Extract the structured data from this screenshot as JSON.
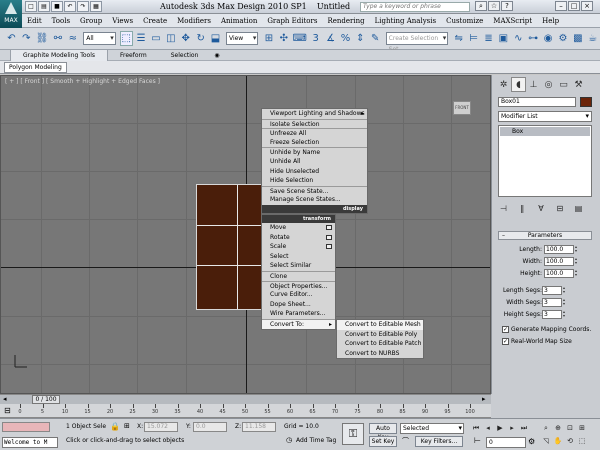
{
  "title_bar": {
    "app_logo": "MAX",
    "title": "Autodesk 3ds Max Design 2010 SP1",
    "document": "Untitled",
    "search_placeholder": "Type a keyword or phrase",
    "quick_access": [
      "new-icon",
      "open-icon",
      "save-icon",
      "undo-icon",
      "redo-icon",
      "project-icon"
    ]
  },
  "menu": [
    "Edit",
    "Tools",
    "Group",
    "Views",
    "Create",
    "Modifiers",
    "Animation",
    "Graph Editors",
    "Rendering",
    "Lighting Analysis",
    "Customize",
    "MAXScript",
    "Help"
  ],
  "toolbar": {
    "filter": "All",
    "ref_coord": "View",
    "selection_set_placeholder": "Create Selection Set"
  },
  "ribbon": {
    "tabs": [
      "Graphite Modeling Tools",
      "Freeform",
      "Selection"
    ],
    "subtab": "Polygon Modeling"
  },
  "viewport": {
    "label": "[ + ] [ Front ] [ Smooth + Highlight + Edged Faces ]",
    "viewcube_label": "FRONT"
  },
  "quad_menu": {
    "display_items": [
      "Viewport Lighting and Shadows",
      "Isolate Selection",
      "Unfreeze All",
      "Freeze Selection",
      "Unhide by Name",
      "Unhide All",
      "Hide Unselected",
      "Hide Selection",
      "Save Scene State...",
      "Manage Scene States..."
    ],
    "display_header": "display",
    "transform_header": "transform",
    "transform_items": [
      "Move",
      "Rotate",
      "Scale",
      "Select",
      "Select Similar",
      "Clone",
      "Object Properties...",
      "Curve Editor...",
      "Dope Sheet...",
      "Wire Parameters...",
      "Convert To:"
    ],
    "convert_submenu": [
      "Convert to Editable Mesh",
      "Convert to Editable Poly",
      "Convert to Editable Patch",
      "Convert to NURBS"
    ]
  },
  "command_panel": {
    "object_name": "Box01",
    "object_color": "#6b2409",
    "modifier_list": "Modifier List",
    "stack_item": "Box",
    "rollout": "Parameters",
    "params": [
      {
        "label": "Length:",
        "value": "100.0"
      },
      {
        "label": "Width:",
        "value": "100.0"
      },
      {
        "label": "Height:",
        "value": "100.0"
      },
      {
        "label": "Length Segs:",
        "value": "3"
      },
      {
        "label": "Width Segs:",
        "value": "3"
      },
      {
        "label": "Height Segs:",
        "value": "3"
      }
    ],
    "checkboxes": [
      {
        "label": "Generate Mapping Coords.",
        "checked": true
      },
      {
        "label": "Real-World Map Size",
        "checked": true
      }
    ]
  },
  "timeline": {
    "slider": "0 / 100",
    "ticks": [
      "0",
      "5",
      "10",
      "15",
      "20",
      "25",
      "30",
      "35",
      "40",
      "45",
      "50",
      "55",
      "60",
      "65",
      "70",
      "75",
      "80",
      "85",
      "90",
      "95",
      "100"
    ]
  },
  "status": {
    "welcome": "Welcome to M",
    "selection": "1 Object Sele",
    "prompt": "Click or click-and-drag to select objects",
    "x_label": "X:",
    "x_val": "15.072",
    "y_label": "Y:",
    "y_val": "0.0",
    "z_label": "Z:",
    "z_val": "11.158",
    "grid": "Grid = 10.0",
    "add_time_tag": "Add Time Tag",
    "auto_key": "Auto Key",
    "set_key": "Set Key",
    "selected": "Selected",
    "key_filters": "Key Filters...",
    "frame": "0"
  }
}
